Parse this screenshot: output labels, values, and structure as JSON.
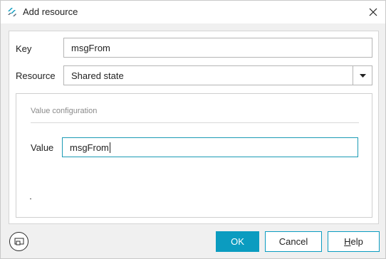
{
  "window": {
    "title": "Add resource"
  },
  "form": {
    "key_label": "Key",
    "key_value": "msgFrom",
    "resource_label": "Resource",
    "resource_value": "Shared state"
  },
  "value_configuration": {
    "group_title": "Value configuration",
    "value_label": "Value",
    "value_value": "msgFrom"
  },
  "buttons": {
    "ok": "OK",
    "cancel": "Cancel",
    "help_prefix": "",
    "help_underlined": "H",
    "help_rest": "elp"
  },
  "icons": {
    "app": "app-logo-icon",
    "close": "close-icon",
    "dropdown": "caret-down-icon",
    "bottom": "window-settings-icon"
  },
  "colors": {
    "accent": "#0b9cc0",
    "input_focus": "#1c9bb5"
  }
}
